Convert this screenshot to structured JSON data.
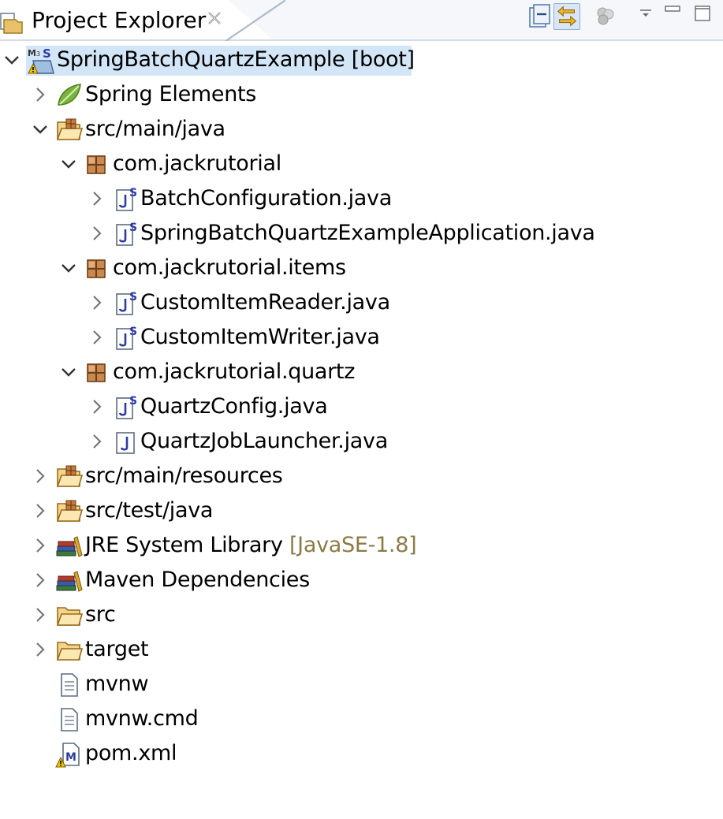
{
  "view": {
    "title": "Project Explorer",
    "toolbar": {
      "collapse_icon": "collapse-all-icon",
      "link_icon": "link-with-editor-icon",
      "filter_icon": "filter-icon",
      "menu_icon": "view-menu-icon",
      "minimize_icon": "minimize-icon",
      "maximize_icon": "maximize-icon"
    }
  },
  "colors": {
    "selection": "#d3e6f7",
    "decoration_text": "#8b7b44",
    "header_bg": "#f5f7fa",
    "link_toggle_bg": "#d8e6f6"
  },
  "tree": {
    "rows": [
      {
        "label": "SpringBatchQuartzExample",
        "decoration": "[boot]",
        "icon": "maven-spring-project-icon",
        "expanded": true,
        "selected": true
      },
      {
        "label": "Spring Elements",
        "icon": "spring-leaf-icon",
        "expanded": false
      },
      {
        "label": "src/main/java",
        "icon": "source-folder-icon",
        "expanded": true
      },
      {
        "label": "com.jackrutorial",
        "icon": "package-icon",
        "expanded": true
      },
      {
        "label": "BatchConfiguration.java",
        "icon": "spring-java-file-icon",
        "expanded": false
      },
      {
        "label": "SpringBatchQuartzExampleApplication.java",
        "icon": "spring-java-file-icon",
        "expanded": false
      },
      {
        "label": "com.jackrutorial.items",
        "icon": "package-icon",
        "expanded": true
      },
      {
        "label": "CustomItemReader.java",
        "icon": "spring-java-file-icon",
        "expanded": false
      },
      {
        "label": "CustomItemWriter.java",
        "icon": "spring-java-file-icon",
        "expanded": false
      },
      {
        "label": "com.jackrutorial.quartz",
        "icon": "package-icon",
        "expanded": true
      },
      {
        "label": "QuartzConfig.java",
        "icon": "spring-java-file-icon",
        "expanded": false
      },
      {
        "label": "QuartzJobLauncher.java",
        "icon": "java-file-icon",
        "expanded": false
      },
      {
        "label": "src/main/resources",
        "icon": "source-folder-icon",
        "expanded": false
      },
      {
        "label": "src/test/java",
        "icon": "source-folder-icon",
        "expanded": false
      },
      {
        "label": "JRE System Library",
        "decoration": "[JavaSE-1.8]",
        "icon": "library-icon",
        "expanded": false
      },
      {
        "label": "Maven Dependencies",
        "icon": "library-icon",
        "expanded": false
      },
      {
        "label": "src",
        "icon": "folder-icon",
        "expanded": false
      },
      {
        "label": "target",
        "icon": "folder-icon",
        "expanded": false
      },
      {
        "label": "mvnw",
        "icon": "text-file-icon"
      },
      {
        "label": "mvnw.cmd",
        "icon": "text-file-icon"
      },
      {
        "label": "pom.xml",
        "icon": "maven-pom-warning-icon"
      }
    ]
  }
}
